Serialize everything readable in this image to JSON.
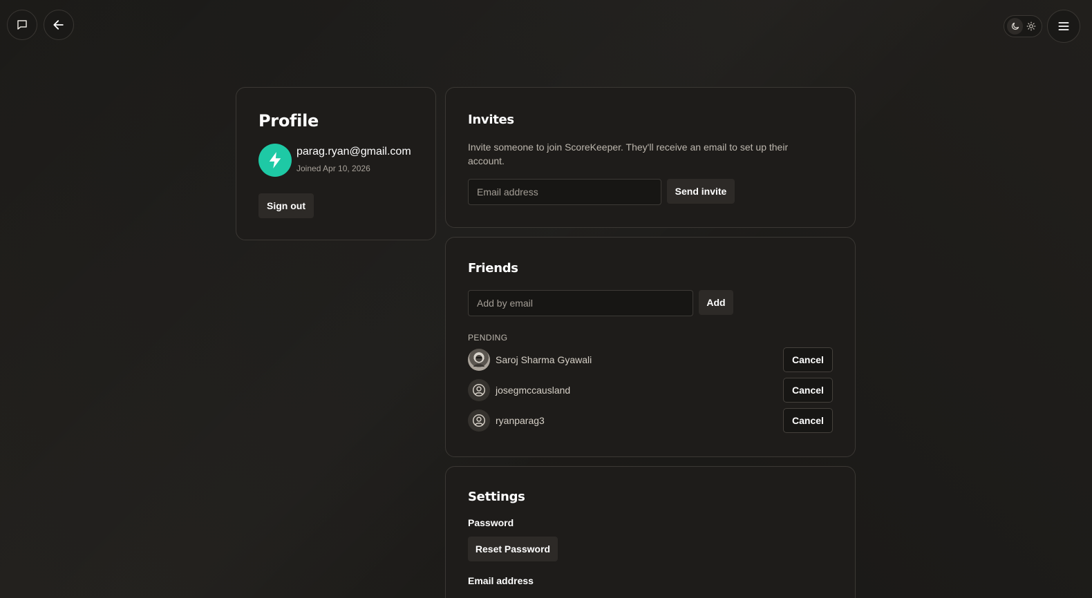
{
  "topbar": {
    "chat_icon": "chat-bubble-icon",
    "back_icon": "arrow-left-icon",
    "theme_dark_icon": "moon-icon",
    "theme_light_icon": "sun-icon",
    "menu_icon": "hamburger-menu-icon"
  },
  "profile": {
    "title": "Profile",
    "email": "parag.ryan@gmail.com",
    "joined": "Joined Apr 10, 2026",
    "avatar_icon": "lightning-bolt-icon",
    "avatar_color": "#1ec9a5",
    "sign_out_label": "Sign out"
  },
  "invites": {
    "title": "Invites",
    "description": "Invite someone to join ScoreKeeper. They'll receive an email to set up their account.",
    "email_placeholder": "Email address",
    "email_value": "",
    "send_label": "Send invite"
  },
  "friends": {
    "title": "Friends",
    "add_placeholder": "Add by email",
    "add_value": "",
    "add_label": "Add",
    "pending_heading": "PENDING",
    "pending": [
      {
        "name": "Saroj Sharma Gyawali",
        "avatar": "photo",
        "action": "Cancel"
      },
      {
        "name": "josegmccausland",
        "avatar": "user-icon",
        "action": "Cancel"
      },
      {
        "name": "ryanparag3",
        "avatar": "user-icon",
        "action": "Cancel"
      }
    ]
  },
  "settings": {
    "title": "Settings",
    "password_label": "Password",
    "reset_label": "Reset Password",
    "email_label": "Email address"
  }
}
